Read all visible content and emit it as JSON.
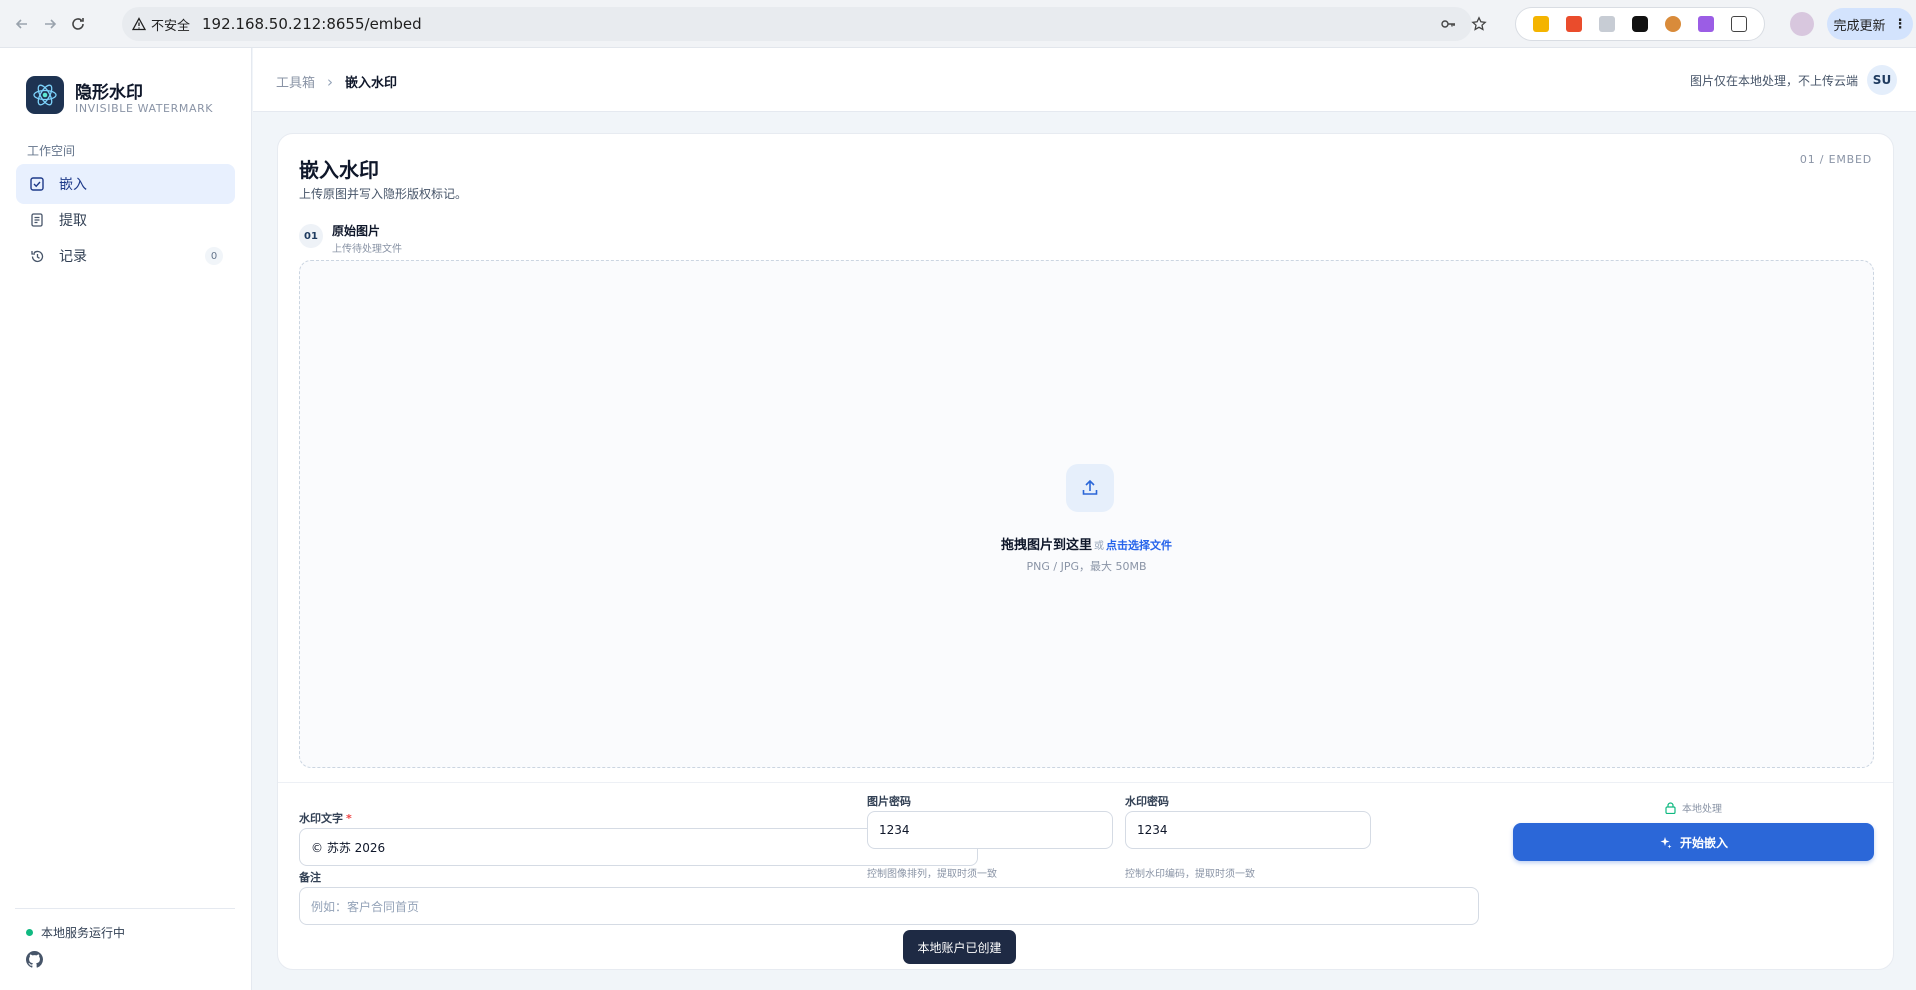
{
  "browser": {
    "security_label": "不安全",
    "url": "192.168.50.212:8655/embed",
    "update_label": "完成更新"
  },
  "sidebar": {
    "brand_title": "隐形水印",
    "brand_subtitle": "INVISIBLE WATERMARK",
    "section_label": "工作空间",
    "items": [
      {
        "label": "嵌入",
        "icon": "check-square-icon",
        "active": true
      },
      {
        "label": "提取",
        "icon": "document-icon",
        "active": false
      },
      {
        "label": "记录",
        "icon": "history-icon",
        "active": false,
        "badge": "0"
      }
    ],
    "service_status": "本地服务运行中",
    "status_color": "#10b981"
  },
  "header": {
    "breadcrumb": [
      "工具箱",
      "嵌入水印"
    ],
    "note": "图片仅在本地处理，不上传云端",
    "avatar": "SU"
  },
  "main": {
    "title": "嵌入水印",
    "subtitle": "上传原图并写入隐形版权标记。",
    "step_tag": "01 / EMBED",
    "step": {
      "number": "01",
      "title": "原始图片",
      "subtitle": "上传待处理文件"
    },
    "dropzone": {
      "main_text": "拖拽图片到这里",
      "or_text": "或",
      "link_text": "点击选择文件",
      "hint": "PNG / JPG，最大 50MB"
    },
    "form": {
      "watermark_label": "水印文字",
      "required_mark": "*",
      "watermark_value": "© 苏苏 2026",
      "image_pwd_label": "图片密码",
      "image_pwd_value": "1234",
      "image_pwd_help": "控制图像排列，提取时须一致",
      "wm_pwd_label": "水印密码",
      "wm_pwd_value": "1234",
      "wm_pwd_help": "控制水印编码，提取时须一致",
      "note_label": "备注",
      "note_placeholder": "例如：客户合同首页",
      "local_note": "本地处理",
      "start_button": "开始嵌入"
    }
  },
  "toast": "本地账户已创建",
  "colors": {
    "accent": "#2b67d8",
    "brand_dark": "#1e3352",
    "active_bg": "#e8f0fe"
  }
}
